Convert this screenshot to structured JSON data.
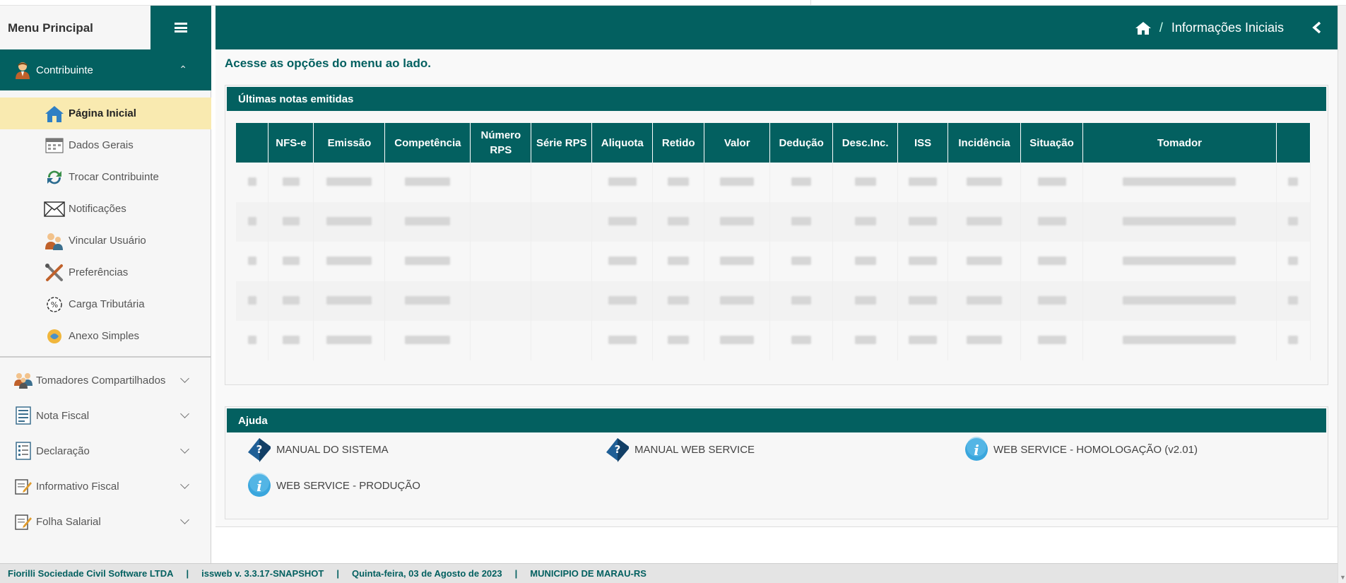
{
  "sidebar": {
    "title": "Menu Principal",
    "contribuinte_label": "Contribuinte",
    "items": [
      {
        "label": "Página Inicial",
        "icon": "home-icon"
      },
      {
        "label": "Dados Gerais",
        "icon": "calendar-icon"
      },
      {
        "label": "Trocar Contribuinte",
        "icon": "refresh-icon"
      },
      {
        "label": "Notificações",
        "icon": "envelope-icon"
      },
      {
        "label": "Vincular Usuário",
        "icon": "users-icon"
      },
      {
        "label": "Preferências",
        "icon": "tools-icon"
      },
      {
        "label": "Carga Tributária",
        "icon": "percent-icon"
      },
      {
        "label": "Anexo Simples",
        "icon": "coin-icon"
      }
    ],
    "groups": [
      {
        "label": "Tomadores Compartilhados",
        "icon": "group-icon"
      },
      {
        "label": "Nota Fiscal",
        "icon": "invoice-icon"
      },
      {
        "label": "Declaração",
        "icon": "document-icon"
      },
      {
        "label": "Informativo Fiscal",
        "icon": "edit-document-icon"
      },
      {
        "label": "Folha Salarial",
        "icon": "payroll-icon"
      }
    ]
  },
  "header": {
    "breadcrumb_separator": "/",
    "page_title": "Informações Iniciais"
  },
  "main": {
    "welcome": "Acesse as opções do menu ao lado.",
    "notes_title": "Últimas notas emitidas",
    "columns": [
      "",
      "NFS-e",
      "Emissão",
      "Competência",
      "Número RPS",
      "Série RPS",
      "Aliquota",
      "Retido",
      "Valor",
      "Dedução",
      "Desc.Inc.",
      "ISS",
      "Incidência",
      "Situação",
      "Tomador",
      ""
    ],
    "row_count": 5,
    "help_title": "Ajuda",
    "help_links": [
      {
        "label": "MANUAL DO SISTEMA",
        "icon": "help-book-icon"
      },
      {
        "label": "MANUAL WEB SERVICE",
        "icon": "help-book-icon"
      },
      {
        "label": "WEB SERVICE - HOMOLOGAÇÃO (v2.01)",
        "icon": "info-icon"
      },
      {
        "label": "WEB SERVICE - PRODUÇÃO",
        "icon": "info-icon"
      }
    ]
  },
  "footer": {
    "company": "Fiorilli Sociedade Civil Software LTDA",
    "version": "issweb v. 3.3.17-SNAPSHOT",
    "date": "Quinta-feira, 03 de Agosto de 2023",
    "municipality": "MUNICIPIO DE MARAU-RS",
    "separator": "|"
  },
  "colors": {
    "primary": "#036060",
    "active_item": "#f9eab0"
  }
}
